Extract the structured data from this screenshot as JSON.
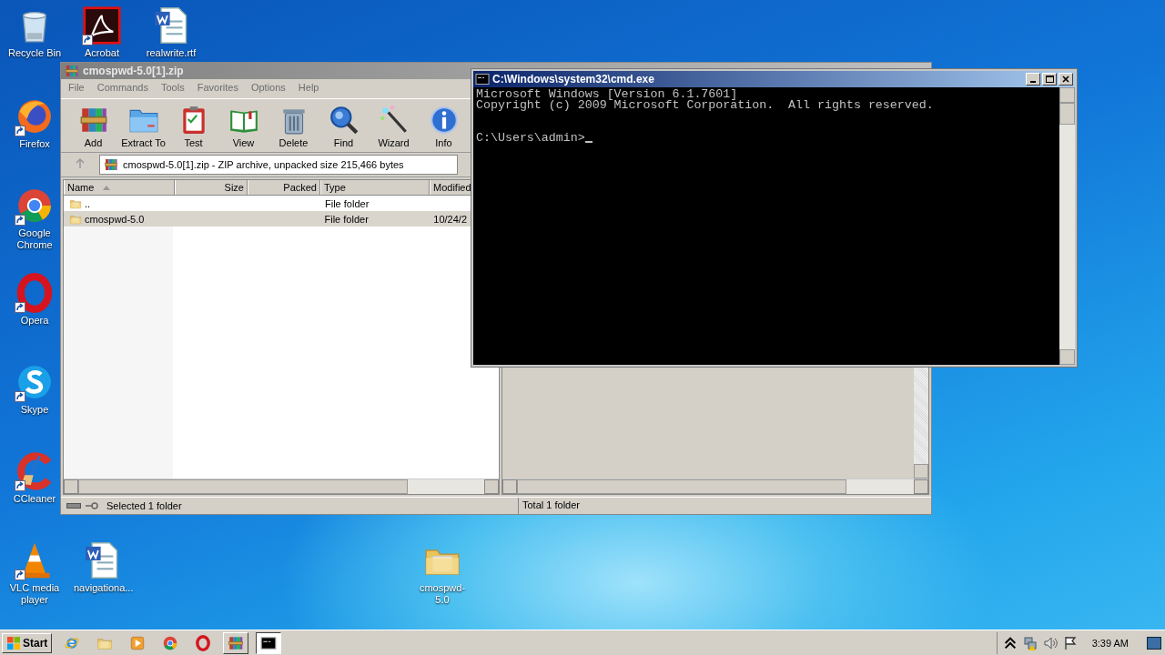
{
  "desktop_icons": [
    {
      "label": "Recycle Bin",
      "kind": "recycle",
      "shortcut": false
    },
    {
      "label": "Acrobat",
      "kind": "acrobat",
      "shortcut": true
    },
    {
      "label": "realwrite.rtf",
      "kind": "word",
      "shortcut": false
    },
    {
      "label": "Firefox",
      "kind": "firefox",
      "shortcut": true
    },
    {
      "label": "Google Chrome",
      "kind": "chrome",
      "shortcut": true
    },
    {
      "label": "Opera",
      "kind": "opera",
      "shortcut": true
    },
    {
      "label": "Skype",
      "kind": "skype",
      "shortcut": true
    },
    {
      "label": "CCleaner",
      "kind": "ccleaner",
      "shortcut": true
    },
    {
      "label": "VLC media player",
      "kind": "vlc",
      "shortcut": true
    },
    {
      "label": "navigationa...",
      "kind": "word",
      "shortcut": false
    },
    {
      "label": "cmospwd-5.0",
      "kind": "folder",
      "shortcut": false
    }
  ],
  "archive_window": {
    "title": "cmospwd-5.0[1].zip",
    "menu": [
      "File",
      "Commands",
      "Tools",
      "Favorites",
      "Options",
      "Help"
    ],
    "toolbar": [
      {
        "label": "Add",
        "kind": "add"
      },
      {
        "label": "Extract To",
        "kind": "extract"
      },
      {
        "label": "Test",
        "kind": "test"
      },
      {
        "label": "View",
        "kind": "view"
      },
      {
        "label": "Delete",
        "kind": "delete"
      },
      {
        "label": "Find",
        "kind": "find"
      },
      {
        "label": "Wizard",
        "kind": "wizard"
      },
      {
        "label": "Info",
        "kind": "info"
      }
    ],
    "address": "cmospwd-5.0[1].zip - ZIP archive, unpacked size 215,466 bytes",
    "columns": [
      "Name",
      "Size",
      "Packed",
      "Type",
      "Modified"
    ],
    "rows": [
      {
        "name": "..",
        "type": "File folder",
        "selected": false
      },
      {
        "name": "cmospwd-5.0",
        "type": "File folder",
        "modified": "10/24/2",
        "selected": true
      }
    ],
    "status_left": "Selected 1 folder",
    "status_right": "Total 1 folder"
  },
  "console_window": {
    "title": "C:\\Windows\\system32\\cmd.exe",
    "lines": [
      "Microsoft Windows [Version 6.1.7601]",
      "Copyright (c) 2009 Microsoft Corporation.  All rights reserved."
    ],
    "prompt": "C:\\Users\\admin>"
  },
  "taskbar": {
    "start": "Start",
    "apps": [
      {
        "kind": "ie",
        "open": false,
        "selected": false
      },
      {
        "kind": "explorer",
        "open": false,
        "selected": false
      },
      {
        "kind": "media",
        "open": false,
        "selected": false
      },
      {
        "kind": "chrome",
        "open": false,
        "selected": false
      },
      {
        "kind": "opera",
        "open": false,
        "selected": false
      },
      {
        "kind": "winrar",
        "open": true,
        "selected": false
      },
      {
        "kind": "cmd",
        "open": true,
        "selected": true
      }
    ],
    "clock": "3:39 AM"
  }
}
